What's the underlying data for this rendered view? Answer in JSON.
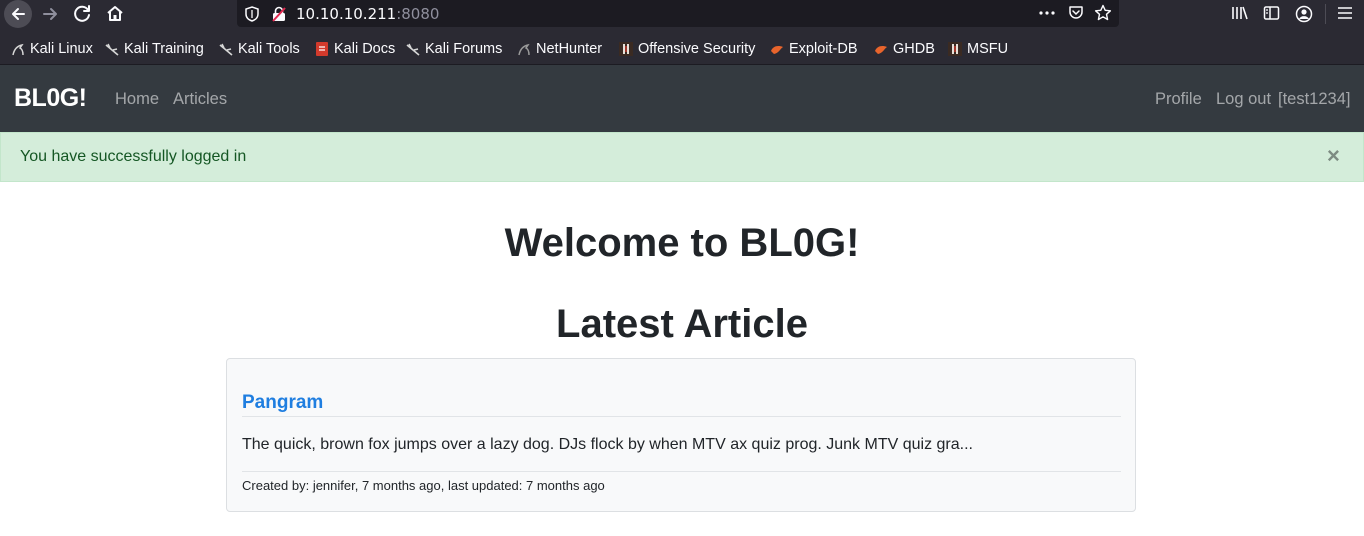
{
  "browser": {
    "url_host": "10.10.10.211",
    "url_port": ":8080"
  },
  "bookmarks": [
    {
      "label": "Kali Linux",
      "icon": "kali-dragon-icon"
    },
    {
      "label": "Kali Training",
      "icon": "kali-dragon-icon"
    },
    {
      "label": "Kali Tools",
      "icon": "kali-dragon-icon"
    },
    {
      "label": "Kali Docs",
      "icon": "kali-docs-icon"
    },
    {
      "label": "Kali Forums",
      "icon": "kali-dragon-icon"
    },
    {
      "label": "NetHunter",
      "icon": "nethunter-icon"
    },
    {
      "label": "Offensive Security",
      "icon": "offsec-icon"
    },
    {
      "label": "Exploit-DB",
      "icon": "exploitdb-icon"
    },
    {
      "label": "GHDB",
      "icon": "ghdb-icon"
    },
    {
      "label": "MSFU",
      "icon": "msfu-icon"
    }
  ],
  "site": {
    "brand": "BL0G!",
    "nav": {
      "home": "Home",
      "articles": "Articles",
      "profile": "Profile",
      "logout": "Log out",
      "user": "[test1234]"
    }
  },
  "alert": {
    "message": "You have successfully logged in",
    "close": "×"
  },
  "main": {
    "welcome": "Welcome to BL0G!",
    "latest_heading": "Latest Article",
    "article": {
      "title": "Pangram",
      "excerpt": "The quick, brown fox jumps over a lazy dog. DJs flock by when MTV ax quiz prog. Junk MTV quiz gra...",
      "meta": "Created by: jennifer, 7 months ago, last updated: 7 months ago"
    }
  },
  "colors": {
    "navbar_bg": "#343a40",
    "alert_bg": "#d4edda",
    "alert_text": "#155724",
    "link": "#1f7ee0"
  }
}
